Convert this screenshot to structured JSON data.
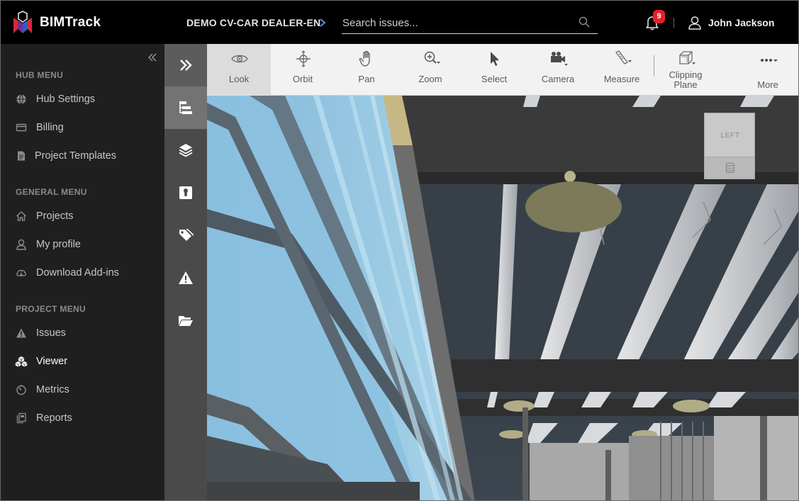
{
  "app": {
    "brand": "BIMTrack",
    "project_name": "DEMO CV-CAR DEALER-EN",
    "search_placeholder": "Search issues...",
    "notifications_count": "9",
    "user_name": "John Jackson"
  },
  "sidebar": {
    "sections": [
      {
        "heading": "HUB MENU",
        "items": [
          {
            "label": "Hub Settings",
            "icon": "globe-icon"
          },
          {
            "label": "Billing",
            "icon": "credit-card-icon"
          },
          {
            "label": "Project Templates",
            "icon": "document-icon"
          }
        ]
      },
      {
        "heading": "GENERAL MENU",
        "items": [
          {
            "label": "Projects",
            "icon": "home-icon"
          },
          {
            "label": "My profile",
            "icon": "user-icon"
          },
          {
            "label": "Download Add-ins",
            "icon": "cloud-download-icon"
          }
        ]
      },
      {
        "heading": "PROJECT MENU",
        "items": [
          {
            "label": "Issues",
            "icon": "warning-icon"
          },
          {
            "label": "Viewer",
            "icon": "cubes-icon",
            "active": true
          },
          {
            "label": "Metrics",
            "icon": "gauge-icon"
          },
          {
            "label": "Reports",
            "icon": "reports-icon"
          }
        ]
      }
    ]
  },
  "toolcolumn": {
    "items": [
      {
        "icon": "expand-panel-icon"
      },
      {
        "icon": "model-tree-icon",
        "active": true
      },
      {
        "icon": "layers-icon"
      },
      {
        "icon": "info-badge-icon"
      },
      {
        "icon": "tags-icon"
      },
      {
        "icon": "issues-warning-icon"
      },
      {
        "icon": "folder-open-icon"
      }
    ]
  },
  "toolbar": {
    "buttons": [
      {
        "label": "Look",
        "icon": "eye-icon",
        "active": true
      },
      {
        "label": "Orbit",
        "icon": "orbit-icon"
      },
      {
        "label": "Pan",
        "icon": "hand-icon"
      },
      {
        "label": "Zoom",
        "icon": "zoom-icon"
      },
      {
        "label": "Select",
        "icon": "cursor-icon"
      },
      {
        "label": "Camera",
        "icon": "camera-icon"
      },
      {
        "label": "Measure",
        "icon": "ruler-icon"
      },
      {
        "label": "Clipping Plane",
        "icon": "clipping-cube-icon"
      },
      {
        "label": "More",
        "icon": "more-dots-icon"
      }
    ]
  },
  "viewcube": {
    "face_label": "LEFT"
  },
  "colors": {
    "topbar": "#000000",
    "sidebar": "#1f1f1f",
    "toolcolumn": "#4a4a4a",
    "toolbar": "#f2f2f2",
    "badge": "#e8202a",
    "glass": "#8fc3e0"
  }
}
